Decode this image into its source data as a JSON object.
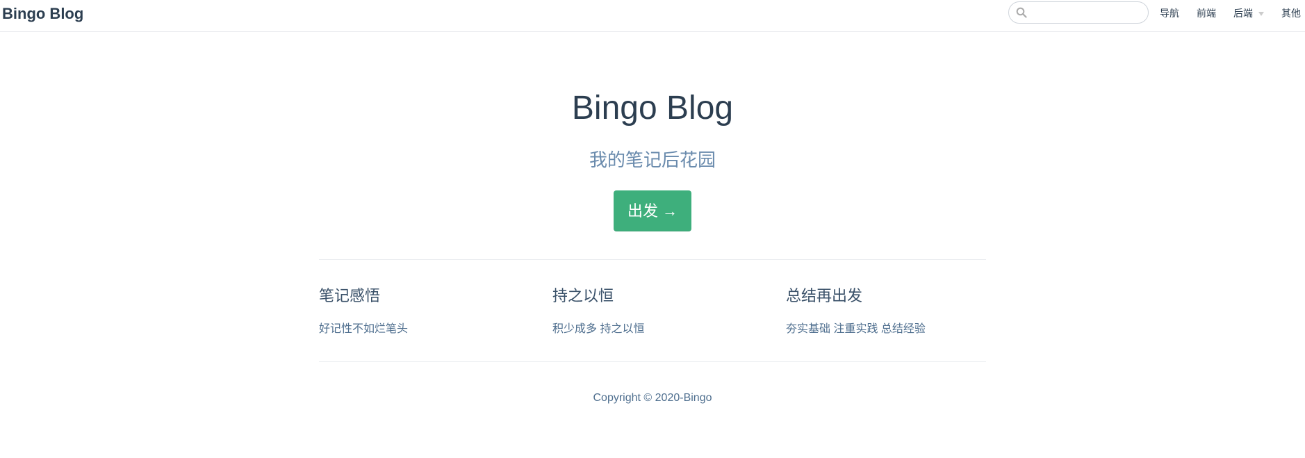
{
  "navbar": {
    "site_name": "Bingo Blog",
    "search": {
      "value": "",
      "placeholder": ""
    },
    "links": [
      {
        "label": "导航"
      },
      {
        "label": "前端"
      },
      {
        "label": "后端",
        "has_dropdown": true
      },
      {
        "label": "其他"
      }
    ]
  },
  "hero": {
    "title": "Bingo Blog",
    "description": "我的笔记后花园",
    "action_label": "出发 →"
  },
  "features": [
    {
      "title": "笔记感悟",
      "details": "好记性不如烂笔头"
    },
    {
      "title": "持之以恒",
      "details": "积少成多 持之以恒"
    },
    {
      "title": "总结再出发",
      "details": "夯实基础 注重实践 总结经验"
    }
  ],
  "footer": {
    "text": "Copyright © 2020-Bingo"
  },
  "colors": {
    "accent": "#3eaf7c",
    "text": "#2c3e50",
    "muted": "#6a8bad"
  }
}
